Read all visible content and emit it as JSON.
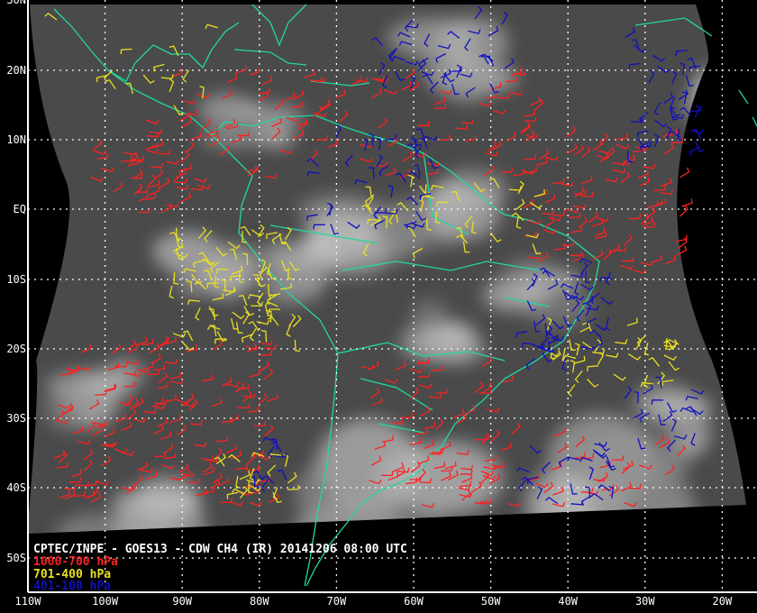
{
  "title": "CPTEC/INPE - GOES13 - CDW CH4 (IR) 20141206 08:00 UTC",
  "legend": [
    {
      "label": "1000-700 hPa",
      "color": "#ff2020"
    },
    {
      "label": "701-400 hPa",
      "color": "#e8e020"
    },
    {
      "label": "401-100 hPa",
      "color": "#1010c0"
    }
  ],
  "lat_labels": [
    "30N",
    "20N",
    "10N",
    "EQ",
    "10S",
    "20S",
    "30S",
    "40S",
    "50S"
  ],
  "lon_labels": [
    "110W",
    "100W",
    "90W",
    "80W",
    "70W",
    "60W",
    "50W",
    "40W",
    "30W",
    "20W"
  ],
  "colors": {
    "coastline": "#20d8a0",
    "grid": "#ffffff",
    "background": "#000000"
  }
}
